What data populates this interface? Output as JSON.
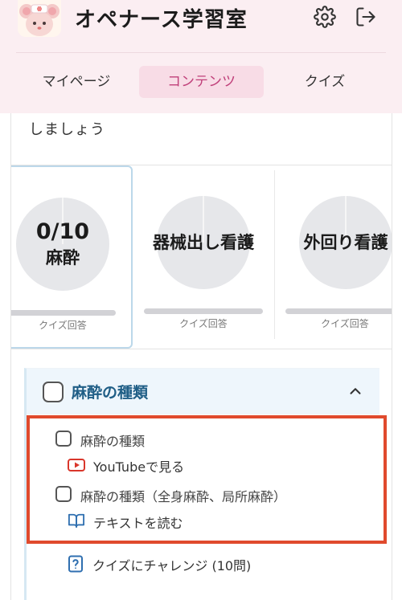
{
  "header": {
    "app_title": "オペナース学習室",
    "logo_icon": "mouse-nurse-mascot",
    "settings_icon": "gear-icon",
    "logout_icon": "logout-icon"
  },
  "tabs": [
    {
      "label": "マイページ",
      "active": false
    },
    {
      "label": "コンテンツ",
      "active": true
    },
    {
      "label": "クイズ",
      "active": false
    }
  ],
  "intro_text": "しましょう",
  "categories": [
    {
      "score": "0/10",
      "name": "麻酔",
      "progress": 0,
      "bar_label": "クイズ回答",
      "selected": true
    },
    {
      "name": "器械出し看護",
      "progress": 0,
      "bar_label": "クイズ回答",
      "selected": false
    },
    {
      "name": "外回り看護",
      "progress": 0,
      "bar_label": "クイズ回答",
      "selected": false
    }
  ],
  "section": {
    "title": "麻酔の種類",
    "expanded": true,
    "items": [
      {
        "title": "麻酔の種類",
        "link_label": "YouTubeで見る",
        "link_icon": "youtube-icon"
      },
      {
        "title": "麻酔の種類（全身麻酔、局所麻酔）",
        "link_label": "テキストを読む",
        "link_icon": "book-icon"
      }
    ],
    "quiz_label": "クイズにチャレンジ (10問)",
    "quiz_icon": "question-icon"
  },
  "colors": {
    "header_bg": "#fbeef2",
    "active_tab_bg": "#f8dce6",
    "active_tab_text": "#c0407a",
    "section_title": "#1f5e86",
    "highlight": "#e04a2d",
    "youtube_red": "#d9362b",
    "link_blue": "#2f6fb0"
  }
}
